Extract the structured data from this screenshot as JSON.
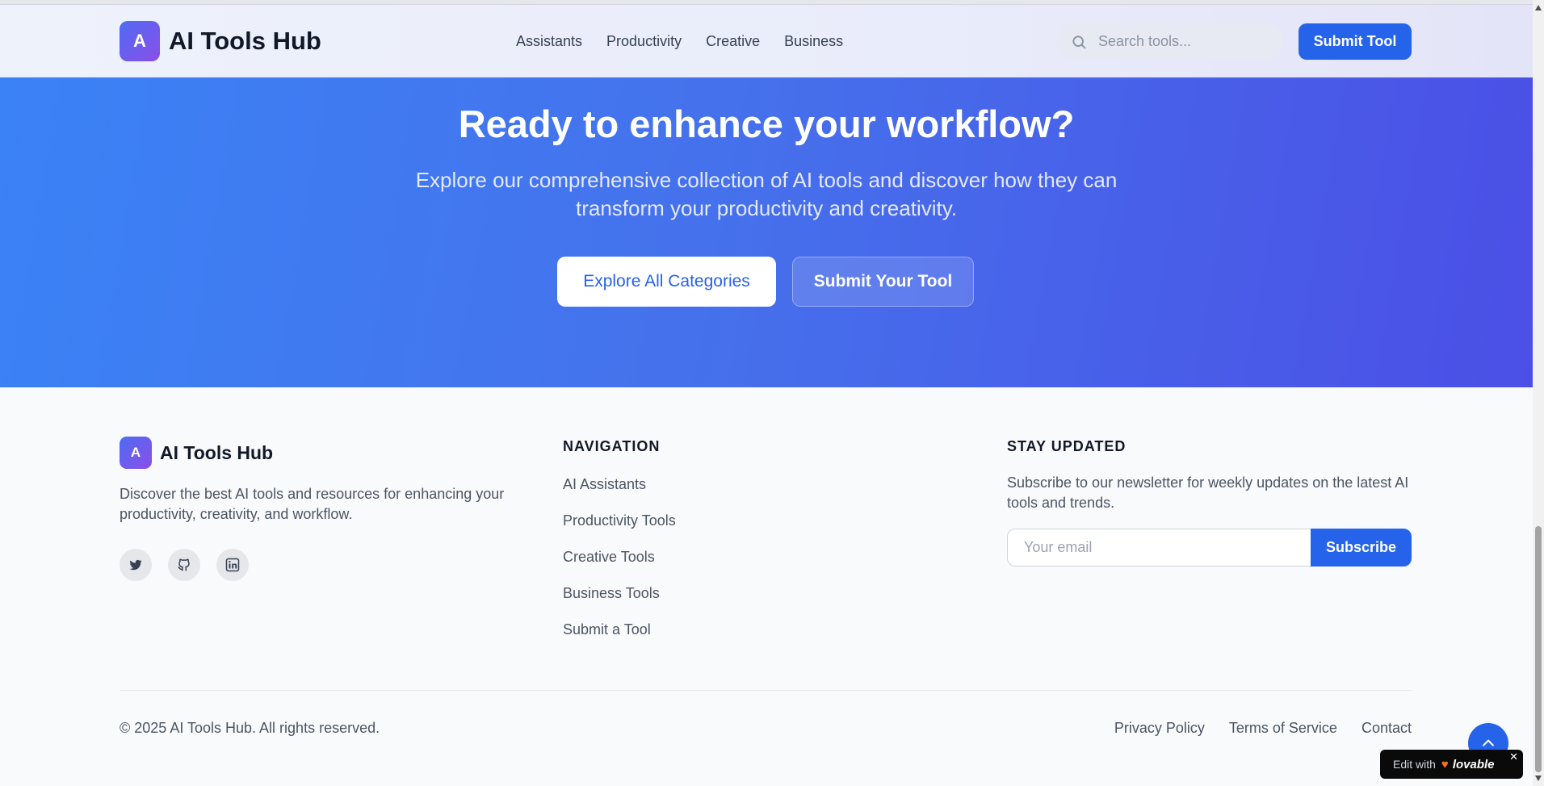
{
  "header": {
    "logo_letter": "A",
    "logo_text": "AI Tools Hub",
    "nav": [
      "Assistants",
      "Productivity",
      "Creative",
      "Business"
    ],
    "search_placeholder": "Search tools...",
    "submit_label": "Submit Tool"
  },
  "hero": {
    "title": "Ready to enhance your workflow?",
    "subtitle": "Explore our comprehensive collection of AI tools and discover how they can transform your productivity and creativity.",
    "primary_button": "Explore All Categories",
    "secondary_button": "Submit Your Tool"
  },
  "footer": {
    "logo_letter": "A",
    "logo_text": "AI Tools Hub",
    "description": "Discover the best AI tools and resources for enhancing your productivity, creativity, and workflow.",
    "socials": [
      "twitter-icon",
      "github-icon",
      "linkedin-icon"
    ],
    "navigation": {
      "title": "NAVIGATION",
      "items": [
        "AI Assistants",
        "Productivity Tools",
        "Creative Tools",
        "Business Tools",
        "Submit a Tool"
      ]
    },
    "newsletter": {
      "title": "STAY UPDATED",
      "description": "Subscribe to our newsletter for weekly updates on the latest AI tools and trends.",
      "email_placeholder": "Your email",
      "button": "Subscribe"
    },
    "copyright": "© 2025 AI Tools Hub. All rights reserved.",
    "legal": [
      "Privacy Policy",
      "Terms of Service",
      "Contact"
    ]
  },
  "badge": {
    "prefix": "Edit with",
    "brand": "lovable"
  },
  "colors": {
    "primary": "#2563eb",
    "hero_start": "#3b82f6",
    "hero_end": "#4b4fe6"
  }
}
